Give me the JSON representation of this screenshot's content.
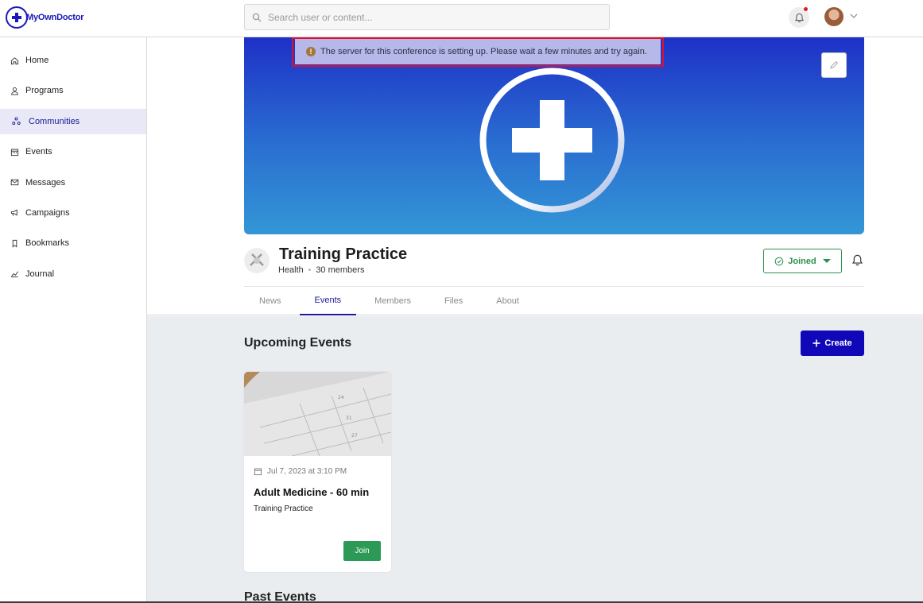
{
  "brand": {
    "name": "MyOwnDoctor",
    "color": "#1a1ab8"
  },
  "search": {
    "placeholder": "Search user or content..."
  },
  "header": {
    "notification_icon": "bell-icon",
    "has_unread": true
  },
  "sidebar": {
    "items": [
      {
        "label": "Home",
        "icon": "home-icon"
      },
      {
        "label": "Programs",
        "icon": "user-icon"
      },
      {
        "label": "Communities",
        "icon": "communities-icon",
        "active": true
      },
      {
        "label": "Events",
        "icon": "calendar-icon"
      },
      {
        "label": "Messages",
        "icon": "mail-icon"
      },
      {
        "label": "Campaigns",
        "icon": "campaign-icon"
      },
      {
        "label": "Bookmarks",
        "icon": "bookmark-icon"
      },
      {
        "label": "Journal",
        "icon": "chart-icon"
      }
    ]
  },
  "alert": {
    "message": "The server for this conference is setting up. Please wait a few minutes and try again."
  },
  "community": {
    "title": "Training Practice",
    "category": "Health",
    "members": "30 members",
    "joined_label": "Joined"
  },
  "tabs": [
    {
      "label": "News"
    },
    {
      "label": "Events",
      "active": true
    },
    {
      "label": "Members"
    },
    {
      "label": "Files"
    },
    {
      "label": "About"
    }
  ],
  "events": {
    "upcoming_title": "Upcoming Events",
    "create_label": "Create",
    "past_title": "Past Events",
    "cards": [
      {
        "date": "Jul 7, 2023 at 3:10 PM",
        "title": "Adult Medicine - 60 min",
        "community": "Training Practice",
        "join_label": "Join"
      }
    ]
  },
  "colors": {
    "accent": "#1a1a9c",
    "success": "#2d8f4f",
    "create": "#1008b8",
    "alert_bg": "#b5b8e8",
    "alert_border": "#e20f2c"
  }
}
